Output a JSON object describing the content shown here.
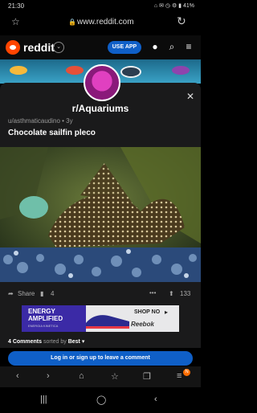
{
  "status": {
    "time": "21:30",
    "icons": "⌂ ✉ ◷  ⚙ ▮ 41%"
  },
  "browser": {
    "url": "www.reddit.com"
  },
  "reddit": {
    "logo": "reddit",
    "use_app": "USE APP"
  },
  "modal": {
    "subreddit": "r/Aquariums",
    "poster": "u/asthmaticaudino • 3y",
    "title": "Chocolate sailfin pleco",
    "share_label": "Share",
    "comment_count": "4",
    "vote_count": "133",
    "comments_text": "4 Comments",
    "sorted_by": "sorted by",
    "sort_value": "Best"
  },
  "ad": {
    "headline_1": "ENERGY",
    "headline_2": "AMPLIFIED",
    "brand_small": "ENERGIA KINETICA",
    "cta": "SHOP NO",
    "brand": "Reebok"
  },
  "login": {
    "label": "Log in or sign up to leave a comment"
  },
  "browser_nav": {
    "tab_badge": "N"
  },
  "colors": {
    "reddit_orange": "#ff4500",
    "primary_blue": "#0f5fc7",
    "modal_bg": "#1a1a1b"
  }
}
